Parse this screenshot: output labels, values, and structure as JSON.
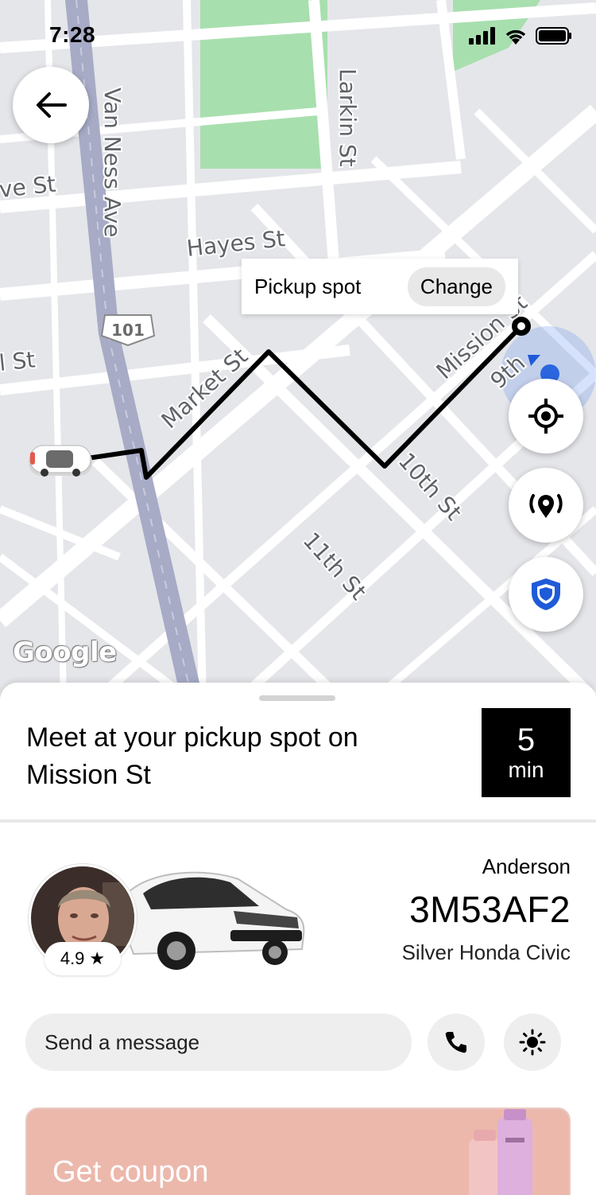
{
  "status_bar": {
    "time": "7:28"
  },
  "map": {
    "streets": {
      "van_ness": "Van Ness Ave",
      "larkin": "Larkin St",
      "hayes": "Hayes St",
      "market": "Market St",
      "mission": "Mission St",
      "tenth": "10th St",
      "eleventh": "11th St",
      "ninth": "9th",
      "ve_st": "ve St",
      "l_st": "l St",
      "route": "101"
    },
    "pickup_popup": {
      "label": "Pickup spot",
      "change": "Change"
    },
    "attribution": "Google"
  },
  "sheet": {
    "headline": "Meet at your pickup spot on Mission St",
    "eta": {
      "value": "5",
      "unit": "min"
    },
    "driver": {
      "name": "Anderson",
      "plate": "3M53AF2",
      "car": "Silver Honda Civic",
      "rating": "4.9",
      "rating_symbol": "★"
    },
    "message": {
      "placeholder": "Send a message"
    },
    "coupon": {
      "title": "Get coupon"
    }
  },
  "colors": {
    "map_bg": "#e5e6ea",
    "highway": "#a7abc6",
    "park": "#a8dfae",
    "route": "#000000",
    "shield": "#1f5bd8",
    "coupon_bg": "#ecb8ac"
  },
  "icons": {
    "back": "arrow-left-icon",
    "locate": "crosshair-icon",
    "broadcast": "broadcast-pin-icon",
    "safety": "shield-icon",
    "phone": "phone-icon",
    "more": "sun-icon"
  }
}
